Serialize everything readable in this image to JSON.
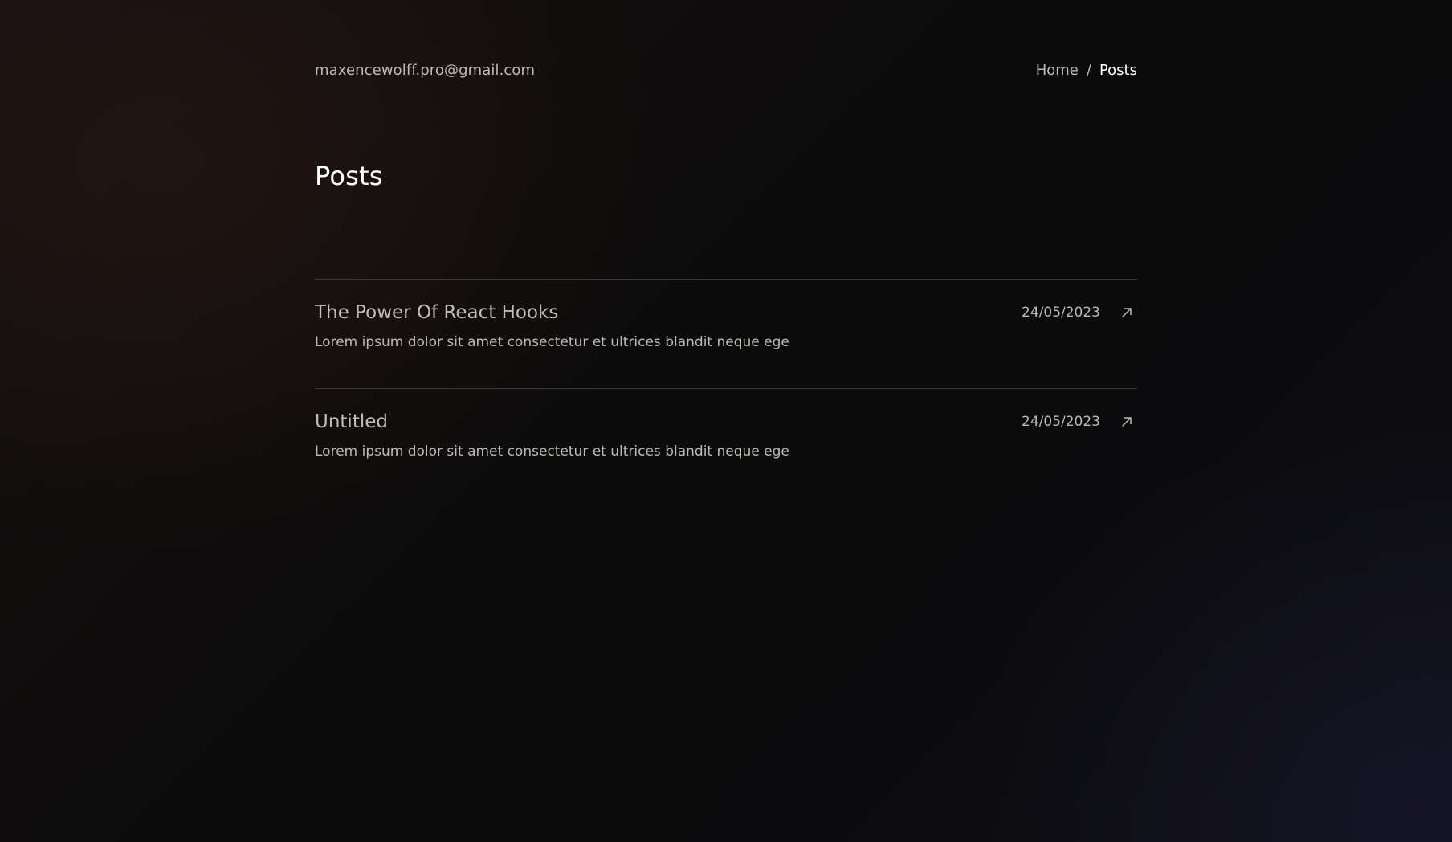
{
  "header": {
    "email": "maxencewolff.pro@gmail.com",
    "breadcrumb": {
      "home": "Home",
      "separator": "/",
      "current": "Posts"
    }
  },
  "page": {
    "title": "Posts"
  },
  "posts": [
    {
      "title": "The Power Of React Hooks",
      "date": "24/05/2023",
      "excerpt": "Lorem ipsum dolor sit amet consectetur et ultrices blandit neque ege",
      "icon": "arrow-up-right-icon"
    },
    {
      "title": "Untitled",
      "date": "24/05/2023",
      "excerpt": "Lorem ipsum dolor sit amet consectetur et ultrices blandit neque ege",
      "icon": "arrow-up-right-icon"
    }
  ],
  "colors": {
    "background": "#0c0b0b",
    "text": "#bdbab6",
    "heading": "#ffffff",
    "divider": "#3a3836"
  }
}
